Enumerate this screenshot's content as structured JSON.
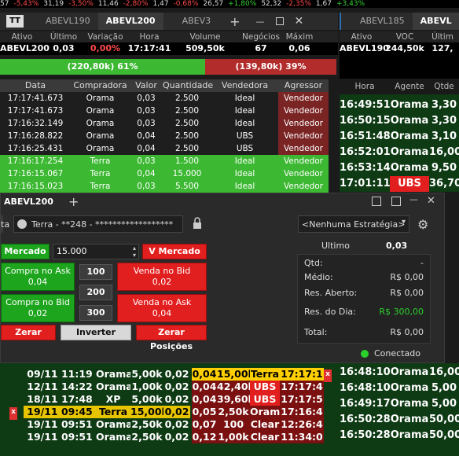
{
  "ticker": [
    {
      "text": "57",
      "cls": "wh"
    },
    {
      "text": "-5,43%",
      "cls": "dn"
    },
    {
      "text": "31,19",
      "cls": "wh"
    },
    {
      "text": "-3,50%",
      "cls": "dn"
    },
    {
      "text": "11,46",
      "cls": "wh"
    },
    {
      "text": "-2,80%",
      "cls": "dn"
    },
    {
      "text": "1,47",
      "cls": "wh"
    },
    {
      "text": "-0,68%",
      "cls": "dn"
    },
    {
      "text": "26,57",
      "cls": "wh"
    },
    {
      "text": "+1,80%",
      "cls": "up"
    },
    {
      "text": "52,32",
      "cls": "wh"
    },
    {
      "text": "-2,35%",
      "cls": "dn"
    },
    {
      "text": "1,67",
      "cls": "wh"
    },
    {
      "text": "+3,43%",
      "cls": "up"
    }
  ],
  "left_window": {
    "logo": "TT",
    "tabs": [
      "ABEVL190",
      "ABEVL200",
      "ABEV3"
    ],
    "active_tab": "ABEVL200",
    "add": "+",
    "quote_headers": [
      "Ativo",
      "Último",
      "Variação",
      "Hora",
      "Volume",
      "Negócios",
      "Máxim"
    ],
    "quote_values": [
      "ABEVL200",
      "0,03",
      "0,00%",
      "17:17:41",
      "509,50k",
      "67",
      "0,06"
    ],
    "buy_bar": "(220,80k) 61%",
    "sell_bar": "(139,80k) 39%",
    "buy_pct": 0.61,
    "trades_headers": [
      "Data",
      "Compradora",
      "Valor",
      "Quantidade",
      "Vendedora",
      "Agressor"
    ],
    "trades": [
      [
        "17:17:41.673",
        "Orama",
        "0,03",
        "2.500",
        "Ideal",
        "Vendedor"
      ],
      [
        "17:17:41.673",
        "Orama",
        "0,03",
        "2.500",
        "Ideal",
        "Vendedor"
      ],
      [
        "17:16:32.149",
        "Orama",
        "0,03",
        "2.500",
        "Ideal",
        "Vendedor"
      ],
      [
        "17:16:28.822",
        "Orama",
        "0,04",
        "2.500",
        "UBS",
        "Vendedor"
      ],
      [
        "17:16:25.431",
        "Orama",
        "0,04",
        "2.500",
        "UBS",
        "Vendedor"
      ],
      [
        "17:16:17.254",
        "Terra",
        "0,03",
        "1.500",
        "Ideal",
        "Vendedor"
      ],
      [
        "17:16:15.067",
        "Terra",
        "0,04",
        "15.000",
        "Ideal",
        "Vendedor"
      ],
      [
        "17:16:15.023",
        "Terra",
        "0,03",
        "5.500",
        "Ideal",
        "Vendedor"
      ]
    ]
  },
  "right_window": {
    "tabs": [
      "ABEVL185",
      "ABEVL"
    ],
    "quote_headers": [
      "Ativo",
      "VOC",
      "Últim"
    ],
    "quote_values": [
      "ABEVL190",
      "244,50k",
      "127,"
    ],
    "book_headers": [
      "Hora",
      "Agente",
      "Qtde"
    ],
    "book": [
      [
        "16:49:51",
        "Orama",
        "3,30"
      ],
      [
        "16:50:15",
        "Orama",
        "3,30"
      ],
      [
        "16:51:48",
        "Orama",
        "3,10"
      ],
      [
        "16:52:01",
        "Orama",
        "16,00"
      ],
      [
        "16:53:14",
        "Orama",
        "9,50"
      ],
      [
        "17:01:11",
        "UBS",
        "36,70"
      ]
    ],
    "book_bottom": [
      [
        "16:48:10",
        "Orama",
        "16,00"
      ],
      [
        "16:48:10",
        "Orama",
        "5,00"
      ],
      [
        "16:49:17",
        "Orama",
        "5,00"
      ],
      [
        "16:50:28",
        "Orama",
        "50,00"
      ],
      [
        "16:50:28",
        "Orama",
        "50,00"
      ]
    ]
  },
  "order_window": {
    "title": "ABEVL200",
    "add": "+",
    "account_label": "ta",
    "account": "Terra - **248 - ******************",
    "strategy": "<Nenhuma Estratégia>",
    "mercado": "Mercado",
    "quantity": "15.000",
    "v_mercado": "V Mercado",
    "compra_ask": "Compra no Ask",
    "compra_ask_val": "0,04",
    "compra_bid": "Compra no Bid",
    "compra_bid_val": "0,02",
    "venda_bid": "Venda no Bid",
    "venda_bid_val": "0,02",
    "venda_ask": "Venda no Ask",
    "venda_ask_val": "0,04",
    "qty_100": "100",
    "qty_200": "200",
    "qty_300": "300",
    "zerar": "Zerar",
    "inverter": "Inverter",
    "zerar_posicoes": "Zerar Posições",
    "ultimo_label": "Ultimo",
    "ultimo_value": "0,03",
    "qtd_label": "Qtd:",
    "qtd_value": "-",
    "medio_label": "Médio:",
    "medio_value": "R$ 0,00",
    "res_aberto_label": "Res. Aberto:",
    "res_aberto_value": "R$ 0,00",
    "res_dia_label": "Res. do Dia:",
    "res_dia_value": "R$ 300,00",
    "total_label": "Total:",
    "total_value": "R$ 0,00",
    "status": "Conectado"
  },
  "bottom_book": [
    {
      "d": "09/11 11:19",
      "a": "Orama",
      "q": "5,00k",
      "p": "0,02",
      "p2": "0,04",
      "q2": "15,00k",
      "a2": "Terra",
      "h2": "17:17:1"
    },
    {
      "d": "12/11 14:22",
      "a": "Orama",
      "q": "1,00k",
      "p": "0,02",
      "p2": "0,04",
      "q2": "42,40k",
      "a2": "UBS",
      "h2": "17:17:4"
    },
    {
      "d": "18/11 17:48",
      "a": "XP",
      "q": "5,00k",
      "p": "0,02",
      "p2": "0,04",
      "q2": "39,60k",
      "a2": "UBS",
      "h2": "17:17:5"
    },
    {
      "d": "19/11 09:45",
      "a": "Terra",
      "q": "15,00k",
      "p": "0,02",
      "p2": "0,05",
      "q2": "2,50k",
      "a2": "Orama",
      "h2": "17:16:4"
    },
    {
      "d": "19/11 09:51",
      "a": "Orama",
      "q": "2,50k",
      "p": "0,02",
      "p2": "0,07",
      "q2": "100",
      "a2": "Clear",
      "h2": "12:26:4"
    },
    {
      "d": "19/11 09:51",
      "a": "Orama",
      "q": "2,50k",
      "p": "0,02",
      "p2": "0,12",
      "q2": "1,00k",
      "a2": "Clear",
      "h2": "11:34:0"
    }
  ],
  "colors": {
    "buy": "#3cb832",
    "sell": "#b32c2c",
    "accent": "#ffd000"
  }
}
